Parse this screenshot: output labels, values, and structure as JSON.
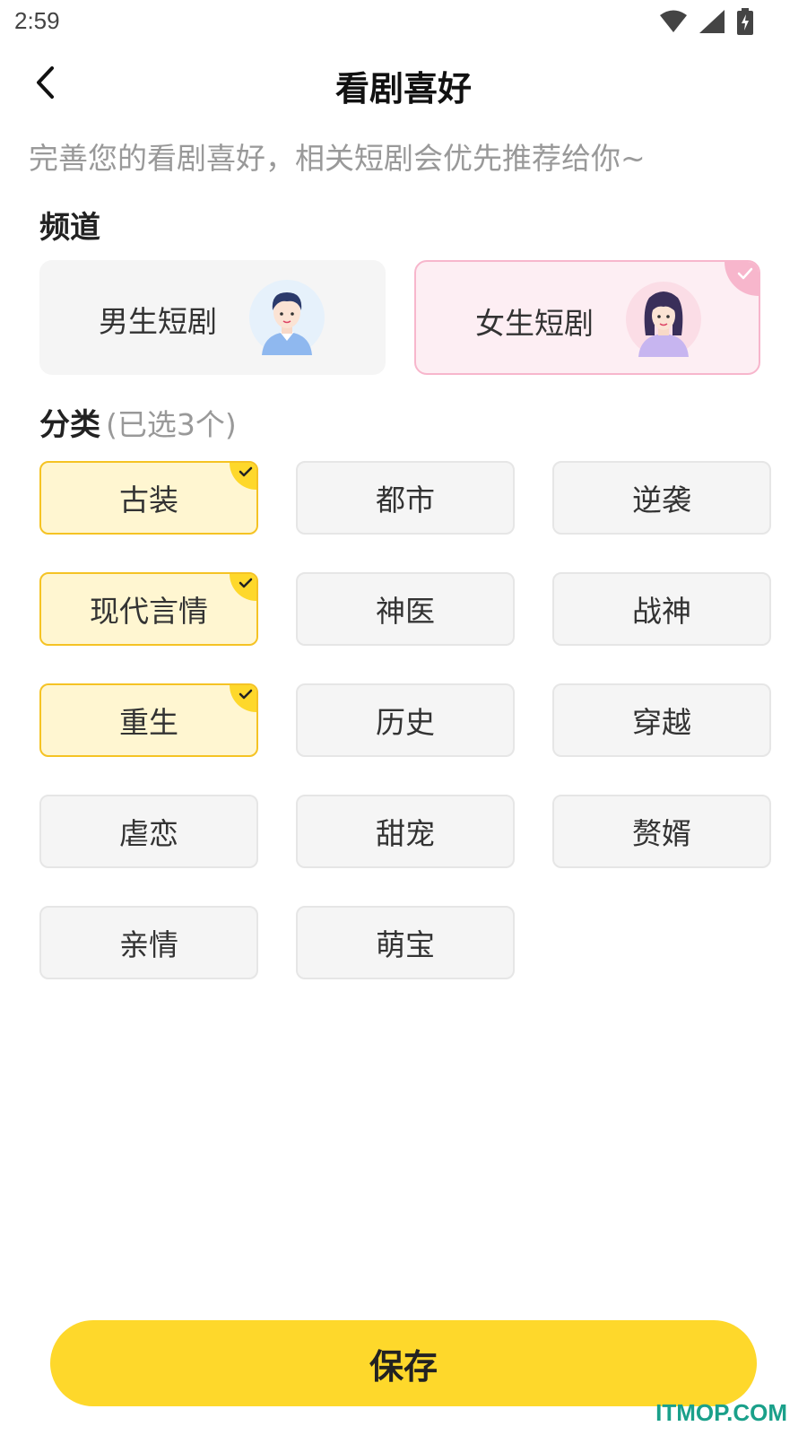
{
  "status": {
    "time": "2:59"
  },
  "nav": {
    "title": "看剧喜好"
  },
  "subtitle": "完善您的看剧喜好，相关短剧会优先推荐给你~",
  "channel_section": {
    "title": "频道",
    "items": [
      {
        "label": "男生短剧",
        "selected": false,
        "avatar": "male-avatar-icon"
      },
      {
        "label": "女生短剧",
        "selected": true,
        "avatar": "female-avatar-icon"
      }
    ]
  },
  "category_section": {
    "title": "分类",
    "note": "(已选3个)",
    "tags": [
      {
        "label": "古装",
        "selected": true
      },
      {
        "label": "都市",
        "selected": false
      },
      {
        "label": "逆袭",
        "selected": false
      },
      {
        "label": "现代言情",
        "selected": true
      },
      {
        "label": "神医",
        "selected": false
      },
      {
        "label": "战神",
        "selected": false
      },
      {
        "label": "重生",
        "selected": true
      },
      {
        "label": "历史",
        "selected": false
      },
      {
        "label": "穿越",
        "selected": false
      },
      {
        "label": "虐恋",
        "selected": false
      },
      {
        "label": "甜宠",
        "selected": false
      },
      {
        "label": "赘婿",
        "selected": false
      },
      {
        "label": "亲情",
        "selected": false
      },
      {
        "label": "萌宝",
        "selected": false
      }
    ]
  },
  "save_button": {
    "label": "保存"
  },
  "watermark": "ITMOP.COM",
  "colors": {
    "accent": "#fed82b",
    "selected_border": "#f5c324",
    "selected_bg": "#fff6d1",
    "pink": "#f7b6cc"
  }
}
